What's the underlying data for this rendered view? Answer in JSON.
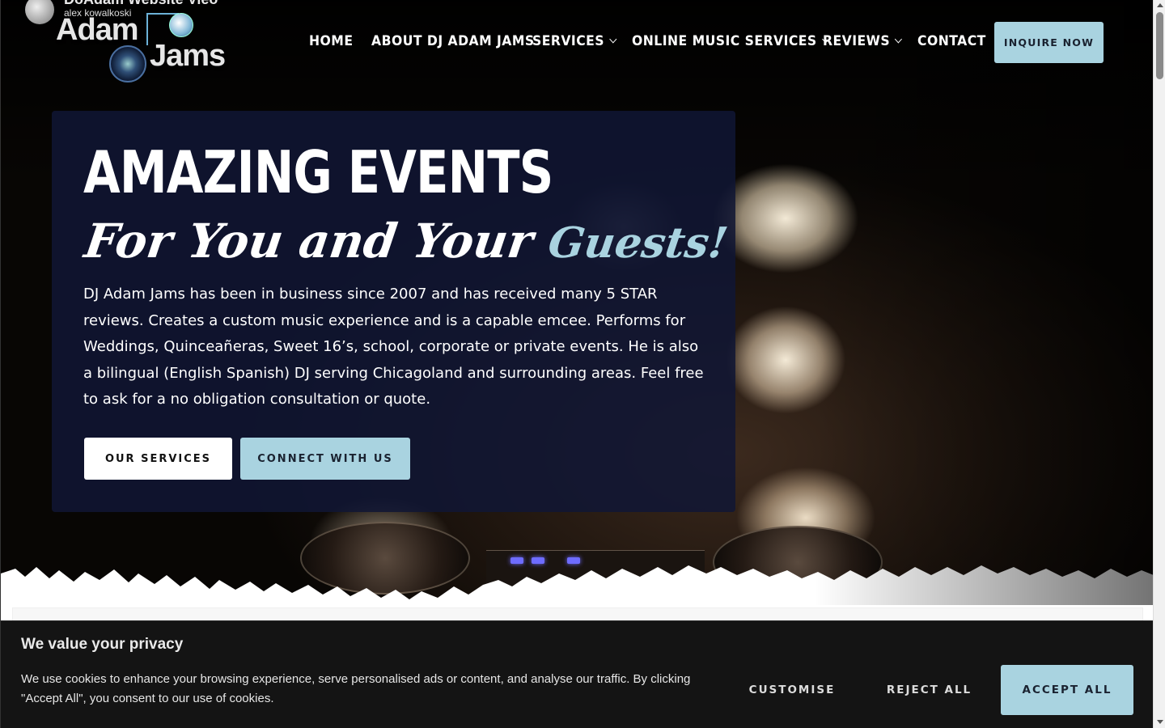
{
  "video": {
    "title": "DoAdam Website Vieo",
    "channel": "alex kowalkoski"
  },
  "logo": {
    "line1": "Adam",
    "line2": "Jams"
  },
  "nav": {
    "items": [
      {
        "label": "HOME",
        "dropdown": false
      },
      {
        "label": "ABOUT DJ ADAM JAMS",
        "dropdown": false
      },
      {
        "label": "SERVICES",
        "dropdown": true
      },
      {
        "label": "ONLINE MUSIC SERVICES",
        "dropdown": true
      },
      {
        "label": "REVIEWS",
        "dropdown": true
      },
      {
        "label": "CONTACT",
        "dropdown": false
      }
    ],
    "cta": "INQUIRE NOW"
  },
  "hero": {
    "headline": "AMAZING EVENTS",
    "script_line": "For You and Your",
    "script_accent": "Guests!",
    "description": "DJ Adam Jams has been in business since 2007 and has received many 5 STAR reviews. Creates a custom music experience and is a capable emcee. Performs for Weddings, Quinceañeras, Sweet 16’s, school, corporate or private events. He is also a bilingual (English Spanish) DJ serving Chicagoland and surrounding areas. Feel free to ask for a no obligation consultation or quote.",
    "primary_button": "OUR SERVICES",
    "secondary_button": "CONNECT WITH US"
  },
  "cookie": {
    "title": "We value your privacy",
    "text": "We use cookies to enhance your browsing experience, serve personalised ads or content, and analyse our traffic. By clicking \"Accept All\", you consent to our use of cookies.",
    "customise": "CUSTOMISE",
    "reject": "REJECT ALL",
    "accept": "ACCEPT ALL"
  },
  "colors": {
    "accent": "#a9d3e0",
    "card": "#10163a",
    "banner": "#141414"
  }
}
